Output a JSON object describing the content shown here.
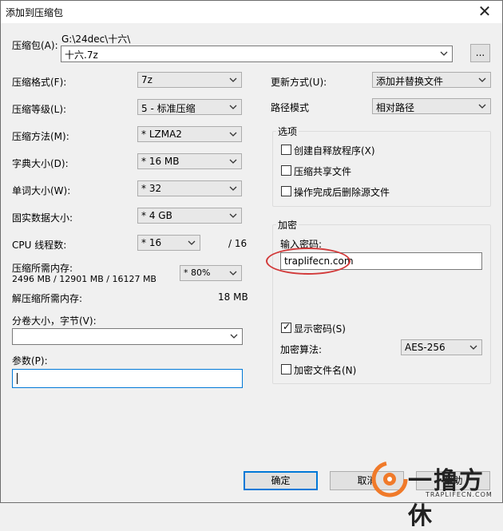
{
  "window": {
    "title": "添加到压缩包",
    "close_glyph": "✕"
  },
  "archive": {
    "label": "压缩包(A):",
    "path": "G:\\24dec\\十六\\",
    "filename": "十六.7z",
    "browse_label": "..."
  },
  "left": {
    "format_label": "压缩格式(F):",
    "format_value": "7z",
    "level_label": "压缩等级(L):",
    "level_value": "5 - 标准压缩",
    "method_label": "压缩方法(M):",
    "method_value": "* LZMA2",
    "dict_label": "字典大小(D):",
    "dict_value": "* 16 MB",
    "word_label": "单词大小(W):",
    "word_value": "* 32",
    "solid_label": "固实数据大小:",
    "solid_value": "* 4 GB",
    "threads_label": "CPU 线程数:",
    "threads_value": "* 16",
    "threads_total": "/ 16",
    "mem_comp_label": "压缩所需内存:",
    "mem_comp_detail": "2496 MB / 12901 MB / 16127 MB",
    "mem_comp_percent": "* 80%",
    "mem_decomp_label": "解压缩所需内存:",
    "mem_decomp_value": "18 MB",
    "split_label": "分卷大小，字节(V):",
    "split_value": "",
    "params_label": "参数(P):",
    "params_value": ""
  },
  "right": {
    "update_label": "更新方式(U):",
    "update_value": "添加并替换文件",
    "path_label": "路径模式",
    "path_value": "相对路径",
    "options_title": "选项",
    "opt_sfx": "创建自释放程序(X)",
    "opt_shared": "压缩共享文件",
    "opt_delete": "操作完成后删除源文件",
    "enc_title": "加密",
    "pwd_label": "输入密码:",
    "pwd_value": "traplifecn.com",
    "show_pwd": "显示密码(S)",
    "enc_method_label": "加密算法:",
    "enc_method_value": "AES-256",
    "enc_names": "加密文件名(N)"
  },
  "buttons": {
    "ok": "确定",
    "cancel": "取消",
    "help": "帮助"
  },
  "watermark": {
    "title": "一撸方休",
    "url": "TRAPLIFECN.COM"
  }
}
